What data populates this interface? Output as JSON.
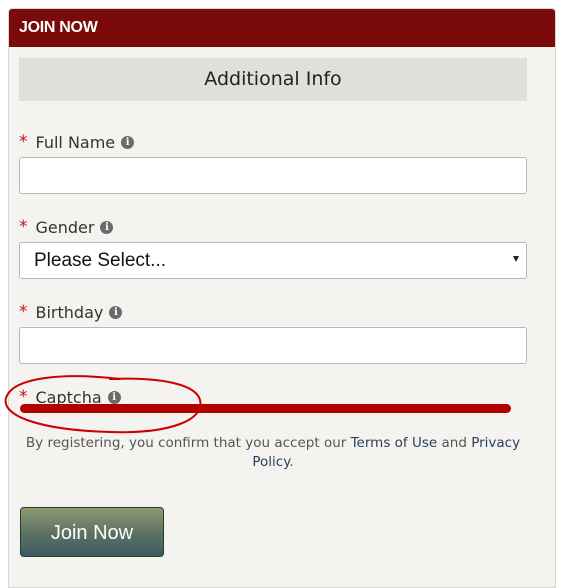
{
  "header": {
    "title": "JOIN NOW"
  },
  "section": {
    "title": "Additional Info"
  },
  "fields": {
    "full_name": {
      "required_mark": "*",
      "label": "Full Name",
      "value": ""
    },
    "gender": {
      "required_mark": "*",
      "label": "Gender",
      "selected": "Please Select..."
    },
    "birthday": {
      "required_mark": "*",
      "label": "Birthday",
      "value": ""
    },
    "captcha": {
      "required_mark": "*",
      "label": "Captcha"
    }
  },
  "icons": {
    "info": "info-circle-icon",
    "dropdown": "caret-down-icon"
  },
  "terms": {
    "prefix": "By registering, you confirm that you accept our",
    "terms_link": "Terms of Use",
    "and": "and",
    "privacy_link": "Privacy Policy",
    "suffix": "."
  },
  "actions": {
    "join_label": "Join Now"
  },
  "colors": {
    "header_bg": "#7b0a0a",
    "required": "#c0141a",
    "captcha_bar": "#b00000",
    "annotation": "#cc0000"
  }
}
